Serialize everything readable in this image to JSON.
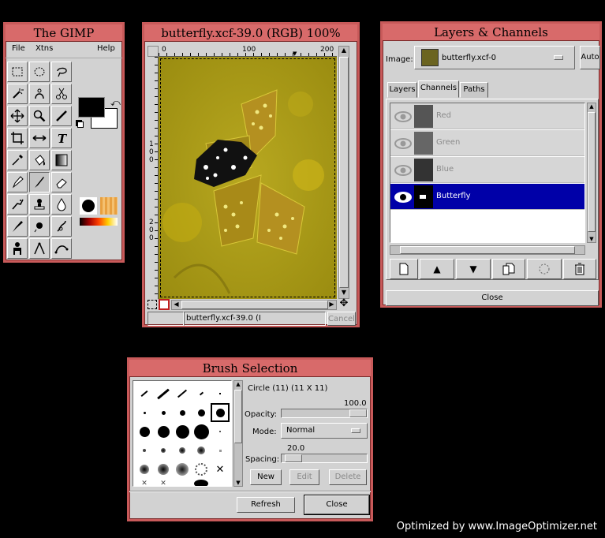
{
  "toolbox": {
    "title": "The GIMP",
    "menu": [
      "File",
      "Xtns",
      "Help"
    ],
    "tools": [
      "rect-select",
      "ellipse-select",
      "free-select",
      "fuzzy-select",
      "bezier-select",
      "scissors",
      "move",
      "magnify",
      "crop",
      "transform",
      "flip",
      "text",
      "color-picker",
      "bucket-fill",
      "blend",
      "pencil",
      "paintbrush",
      "eraser",
      "airbrush",
      "clone",
      "convolve",
      "ink",
      "dodge-burn",
      "smudge",
      "measure",
      "path",
      "sharpen"
    ],
    "fg_color": "#000000",
    "bg_color": "#ffffff"
  },
  "image_window": {
    "title": "butterfly.xcf-39.0 (RGB) 100%",
    "ruler_h": [
      "0",
      "100",
      "200"
    ],
    "ruler_v": [
      "1",
      "0",
      "0",
      "2",
      "0",
      "0"
    ],
    "status_text": "butterfly.xcf-39.0 (I",
    "cancel_label": "Cancel"
  },
  "layers_channels": {
    "title": "Layers & Channels",
    "image_label": "Image:",
    "image_value": "butterfly.xcf-0",
    "auto_label": "Auto",
    "tabs": [
      "Layers",
      "Channels",
      "Paths"
    ],
    "active_tab": "Channels",
    "channels": [
      {
        "name": "Red",
        "selected": false
      },
      {
        "name": "Green",
        "selected": false
      },
      {
        "name": "Blue",
        "selected": false
      },
      {
        "name": "Butterfly",
        "selected": true
      }
    ],
    "close_label": "Close"
  },
  "brush_selection": {
    "title": "Brush Selection",
    "brush_info": "Circle (11)  (11 X 11)",
    "opacity_label": "Opacity:",
    "opacity_value": "100.0",
    "mode_label": "Mode:",
    "mode_value": "Normal",
    "spacing_label": "Spacing:",
    "spacing_value": "20.0",
    "new_label": "New",
    "edit_label": "Edit",
    "delete_label": "Delete",
    "refresh_label": "Refresh",
    "close_label": "Close"
  },
  "watermark": "Optimized by www.ImageOptimizer.net"
}
